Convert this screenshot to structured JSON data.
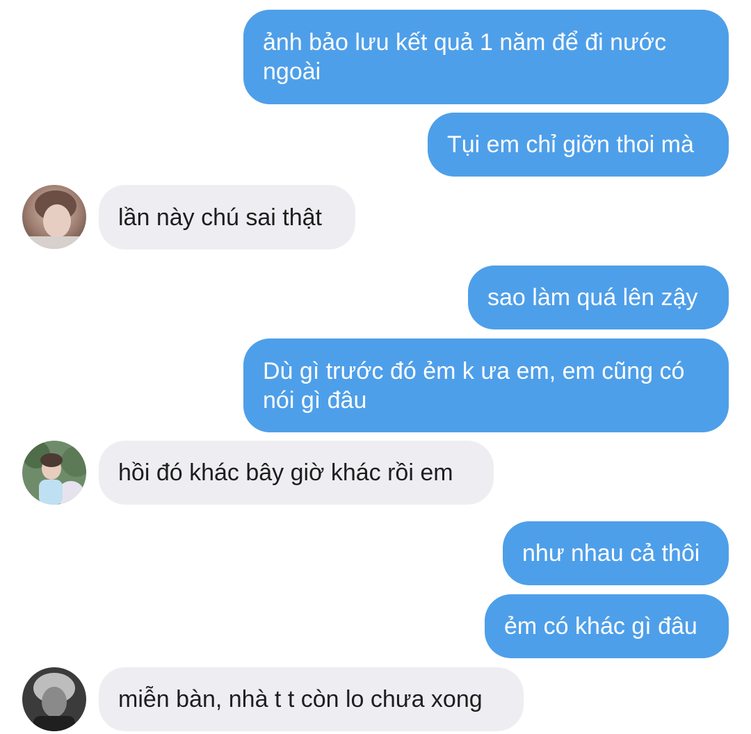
{
  "messages": [
    {
      "side": "out",
      "text": "ảnh bảo lưu kết quả 1 năm để đi nước ngoài"
    },
    {
      "side": "out",
      "text": "Tụi em chỉ giỡn thoi mà"
    },
    {
      "side": "in",
      "text": "lần này chú sai thật",
      "avatar": "profile-photo-icon"
    },
    {
      "side": "out",
      "text": "sao làm quá lên zậy"
    },
    {
      "side": "out",
      "text": "Dù gì trước đó ẻm k ưa em, em cũng có nói gì đâu"
    },
    {
      "side": "in",
      "text": "hồi đó khác bây giờ khác rồi em",
      "avatar": "profile-photo-icon"
    },
    {
      "side": "out",
      "text": "như nhau cả thôi"
    },
    {
      "side": "out",
      "text": "ẻm có khác gì đâu"
    },
    {
      "side": "in",
      "text": "miễn bàn, nhà t t còn lo chưa xong",
      "avatar": "profile-photo-icon"
    }
  ],
  "colors": {
    "outgoing_bubble": "#4e9fe9",
    "incoming_bubble": "#eeeef2",
    "outgoing_text": "#ffffff",
    "incoming_text": "#1e1e1e"
  }
}
